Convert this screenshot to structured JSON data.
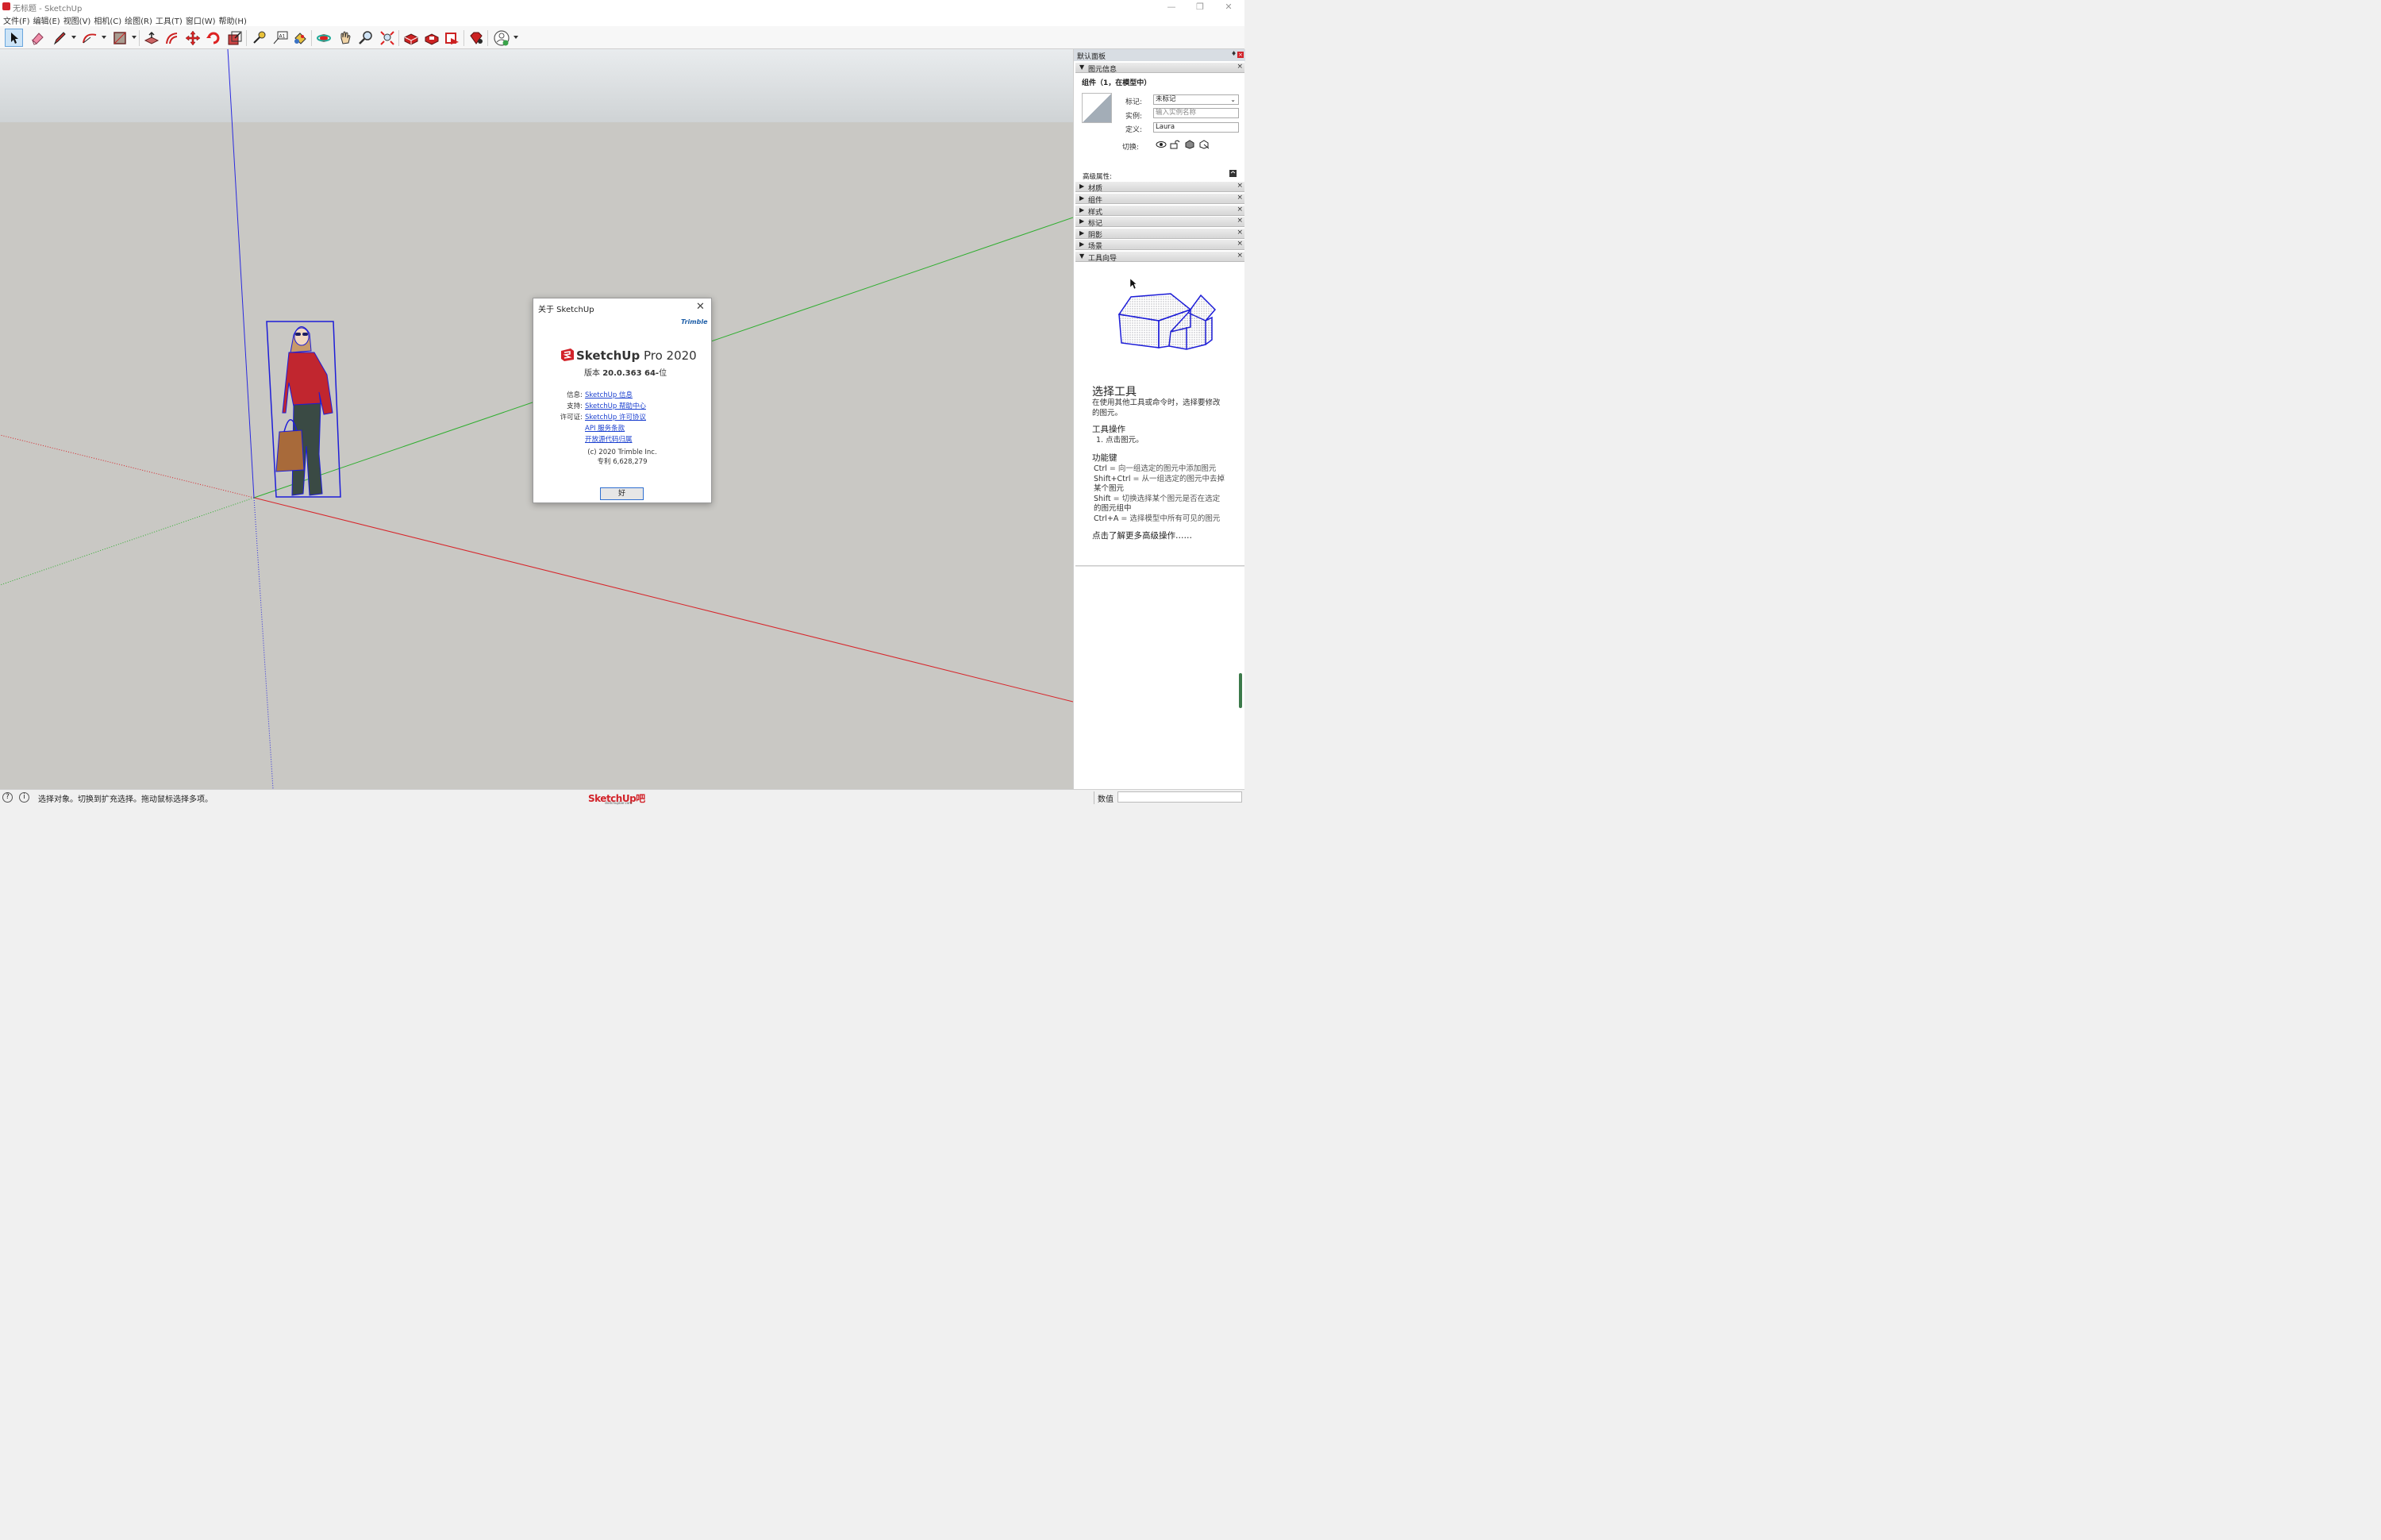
{
  "window": {
    "title": "无标题 - SketchUp",
    "controls": [
      "—",
      "❐",
      "✕"
    ]
  },
  "menu": [
    "文件(F)",
    "编辑(E)",
    "视图(V)",
    "相机(C)",
    "绘图(R)",
    "工具(T)",
    "窗口(W)",
    "帮助(H)"
  ],
  "toolbar": {
    "tools": [
      "select-tool",
      "eraser-tool",
      "pencil-tool",
      "arc-tool",
      "rectangle-tool",
      "push-pull-tool",
      "offset-tool",
      "move-tool",
      "rotate-tool",
      "scale-tool",
      "tape-measure-tool",
      "text-tool",
      "paint-bucket-tool",
      "orbit-tool",
      "pan-tool",
      "zoom-tool",
      "zoom-extents-tool",
      "3d-warehouse",
      "extension-warehouse",
      "layout-send",
      "extension-manager",
      "account"
    ]
  },
  "about_dialog": {
    "title": "关于 SketchUp",
    "brand": "Trimble",
    "product_bold": "SketchUp",
    "product_edition": " Pro 2020",
    "version_prefix": "版本 ",
    "version_number": "20.0.363 64-",
    "version_suffix": "位",
    "info_rows": [
      {
        "label": "信息:",
        "link": "SketchUp 信息"
      },
      {
        "label": "支持:",
        "link": "SketchUp 帮助中心"
      },
      {
        "label": "许可证:",
        "link": "SketchUp 许可协议"
      },
      {
        "label": "",
        "link": "API 服务条款"
      },
      {
        "label": "",
        "link": "开放源代码归属"
      }
    ],
    "copyright": "(c) 2020 Trimble Inc.",
    "patent": "专利 6,628,279",
    "ok_label": "好"
  },
  "right_panel": {
    "title": "默认面板",
    "entity_info": {
      "tray_label": "图元信息",
      "entity_title": "组件（1，在模型中）",
      "tag_label": "标记:",
      "tag_value": "未标记",
      "instance_label": "实例:",
      "instance_placeholder": "输入实例名称",
      "definition_label": "定义:",
      "definition_value": "Laura",
      "toggle_label": "切换:",
      "advanced_label": "高级属性:"
    },
    "trays": [
      "材质",
      "组件",
      "样式",
      "标记",
      "阴影",
      "场景",
      "工具向导"
    ],
    "instructor": {
      "tool_name": "选择工具",
      "intro_1": "在使用其他工具或命令时，选择要修改",
      "intro_2": "的图元。",
      "ops_title": "工具操作",
      "op_1": "1. 点击图元。",
      "keys_title": "功能键",
      "keys": [
        {
          "key": "Ctrl",
          "desc": " = 向一组选定的图元中添加图元"
        },
        {
          "key": "Shift+Ctrl",
          "desc": " = 从一组选定的图元中去掉"
        },
        {
          "key": "",
          "desc": "某个图元"
        },
        {
          "key": "Shift",
          "desc": " = 切换选择某个图元是否在选定"
        },
        {
          "key": "",
          "desc": "的图元组中"
        },
        {
          "key": "Ctrl+A",
          "desc": " = 选择模型中所有可见的图元"
        }
      ],
      "more_link": "点击了解更多高级操作……"
    }
  },
  "status_bar": {
    "text": "选择对象。切换到扩充选择。拖动鼠标选择多项。",
    "watermark": "SketchUp吧",
    "watermark_sub": "sketchupbar.com",
    "measure_label": "数值",
    "measure_value": ""
  },
  "colors": {
    "accent": "#2f6fd0",
    "brand_red": "#d2232a",
    "link": "#1a3fcf",
    "axis_red": "#d7262b",
    "axis_green": "#2fae2f",
    "axis_blue": "#2a2adf",
    "ground": "#c9c8c4"
  }
}
